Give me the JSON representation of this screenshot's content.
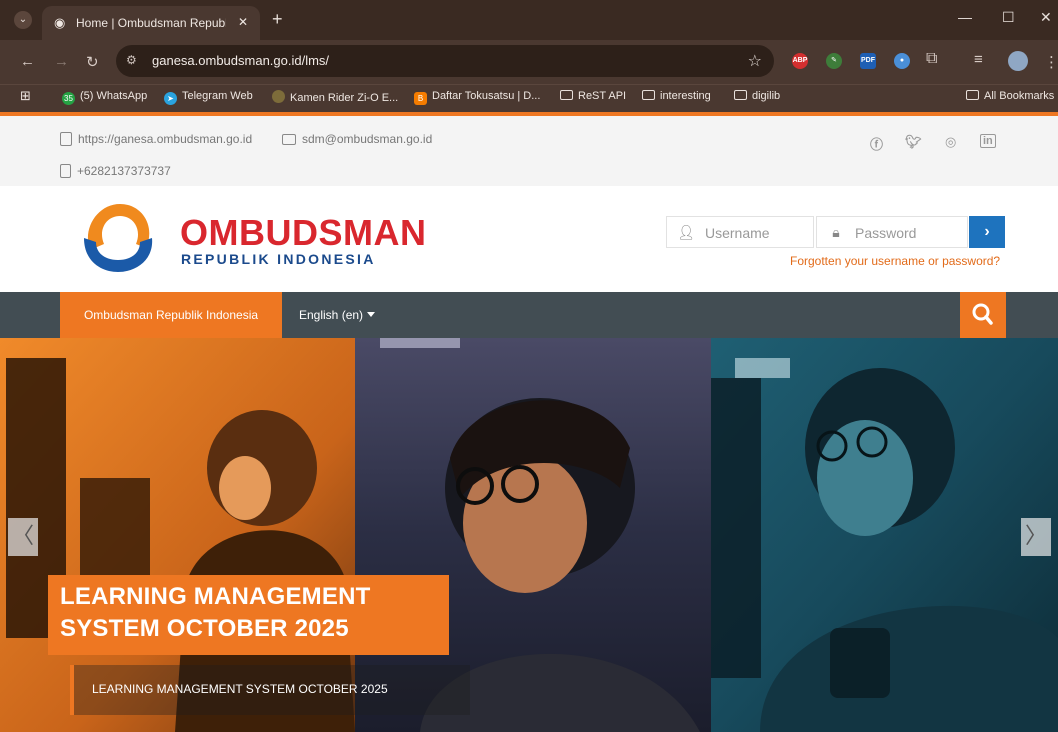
{
  "browser": {
    "tab_title": "Home | Ombudsman Republik I",
    "url": "ganesa.ombudsman.go.id/lms/",
    "bookmarks": [
      {
        "label": "(5) WhatsApp",
        "badge": "35"
      },
      {
        "label": "Telegram Web"
      },
      {
        "label": "Kamen Rider Zi-O E..."
      },
      {
        "label": "Daftar Tokusatsu | D..."
      },
      {
        "label": "ReST API"
      },
      {
        "label": "interesting"
      },
      {
        "label": "digilib"
      },
      {
        "label": "All Bookmarks"
      }
    ],
    "extensions": [
      "ABP",
      "PDF"
    ]
  },
  "infobar": {
    "website": "https://ganesa.ombudsman.go.id",
    "email": "sdm@ombudsman.go.id",
    "phone": "+6282137373737",
    "social_icons": [
      "facebook-icon",
      "twitter-icon",
      "instagram-icon",
      "linkedin-icon"
    ]
  },
  "header": {
    "logo_title": "OMBUDSMAN",
    "logo_subtitle": "REPUBLIK INDONESIA",
    "username_placeholder": "Username",
    "password_placeholder": "Password",
    "forgot_link": "Forgotten your username or password?"
  },
  "nav": {
    "home": "Ombudsman Republik Indonesia",
    "language": "English (en)"
  },
  "hero": {
    "title": "LEARNING MANAGEMENT SYSTEM OCTOBER 2025",
    "subtitle": "LEARNING MANAGEMENT SYSTEM OCTOBER 2025",
    "prev_glyph": "〈",
    "next_glyph": "〉"
  },
  "colors": {
    "accent": "#ee7722",
    "nav_bg": "#424d53",
    "login_button": "#1e73be",
    "logo_red": "#d9272e",
    "logo_blue": "#1b4a8c"
  }
}
